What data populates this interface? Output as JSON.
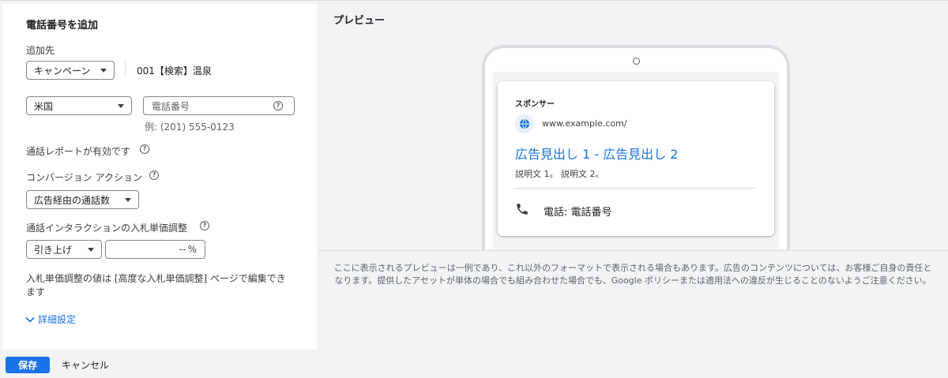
{
  "form": {
    "title": "電話番号を追加",
    "add_to_label": "追加先",
    "level_select": "キャンペーン",
    "campaign_name": "001【検索】温泉",
    "country_select": "米国",
    "phone_placeholder": "電話番号",
    "phone_example": "例: (201) 555-0123",
    "call_report_label": "通話レポートが有効です",
    "conversion_label": "コンバージョン アクション",
    "conversion_select": "広告経由の通話数",
    "bid_adjust_label": "通話インタラクションの入札単価調整",
    "bid_direction_select": "引き上げ",
    "bid_value": "--",
    "bid_unit": "%",
    "bid_note": "入札単価調整の値は [高度な入札単価調整] ページで編集できます",
    "advanced_link": "詳細設定"
  },
  "preview": {
    "title": "プレビュー",
    "sponsor": "スポンサー",
    "url": "www.example.com/",
    "headline": "広告見出し 1 - 広告見出し 2",
    "description": "説明文 1。 説明文 2。",
    "call_text": "電話: 電話番号",
    "notice": "ここに表示されるプレビューは一例であり、これ以外のフォーマットで表示される場合もあります。広告のコンテンツについては、お客様ご自身の責任となります。提供したアセットが単体の場合でも組み合わせた場合でも、Google ポリシーまたは適用法への違反が生じることのないようご注意ください。"
  },
  "footer": {
    "save": "保存",
    "cancel": "キャンセル"
  },
  "icons": [
    "help-icon",
    "globe-icon",
    "phone-icon",
    "chevron-down-icon",
    "dropdown-arrow-icon"
  ],
  "colors": {
    "accent": "#1a73e8",
    "link": "#1a0dab"
  }
}
